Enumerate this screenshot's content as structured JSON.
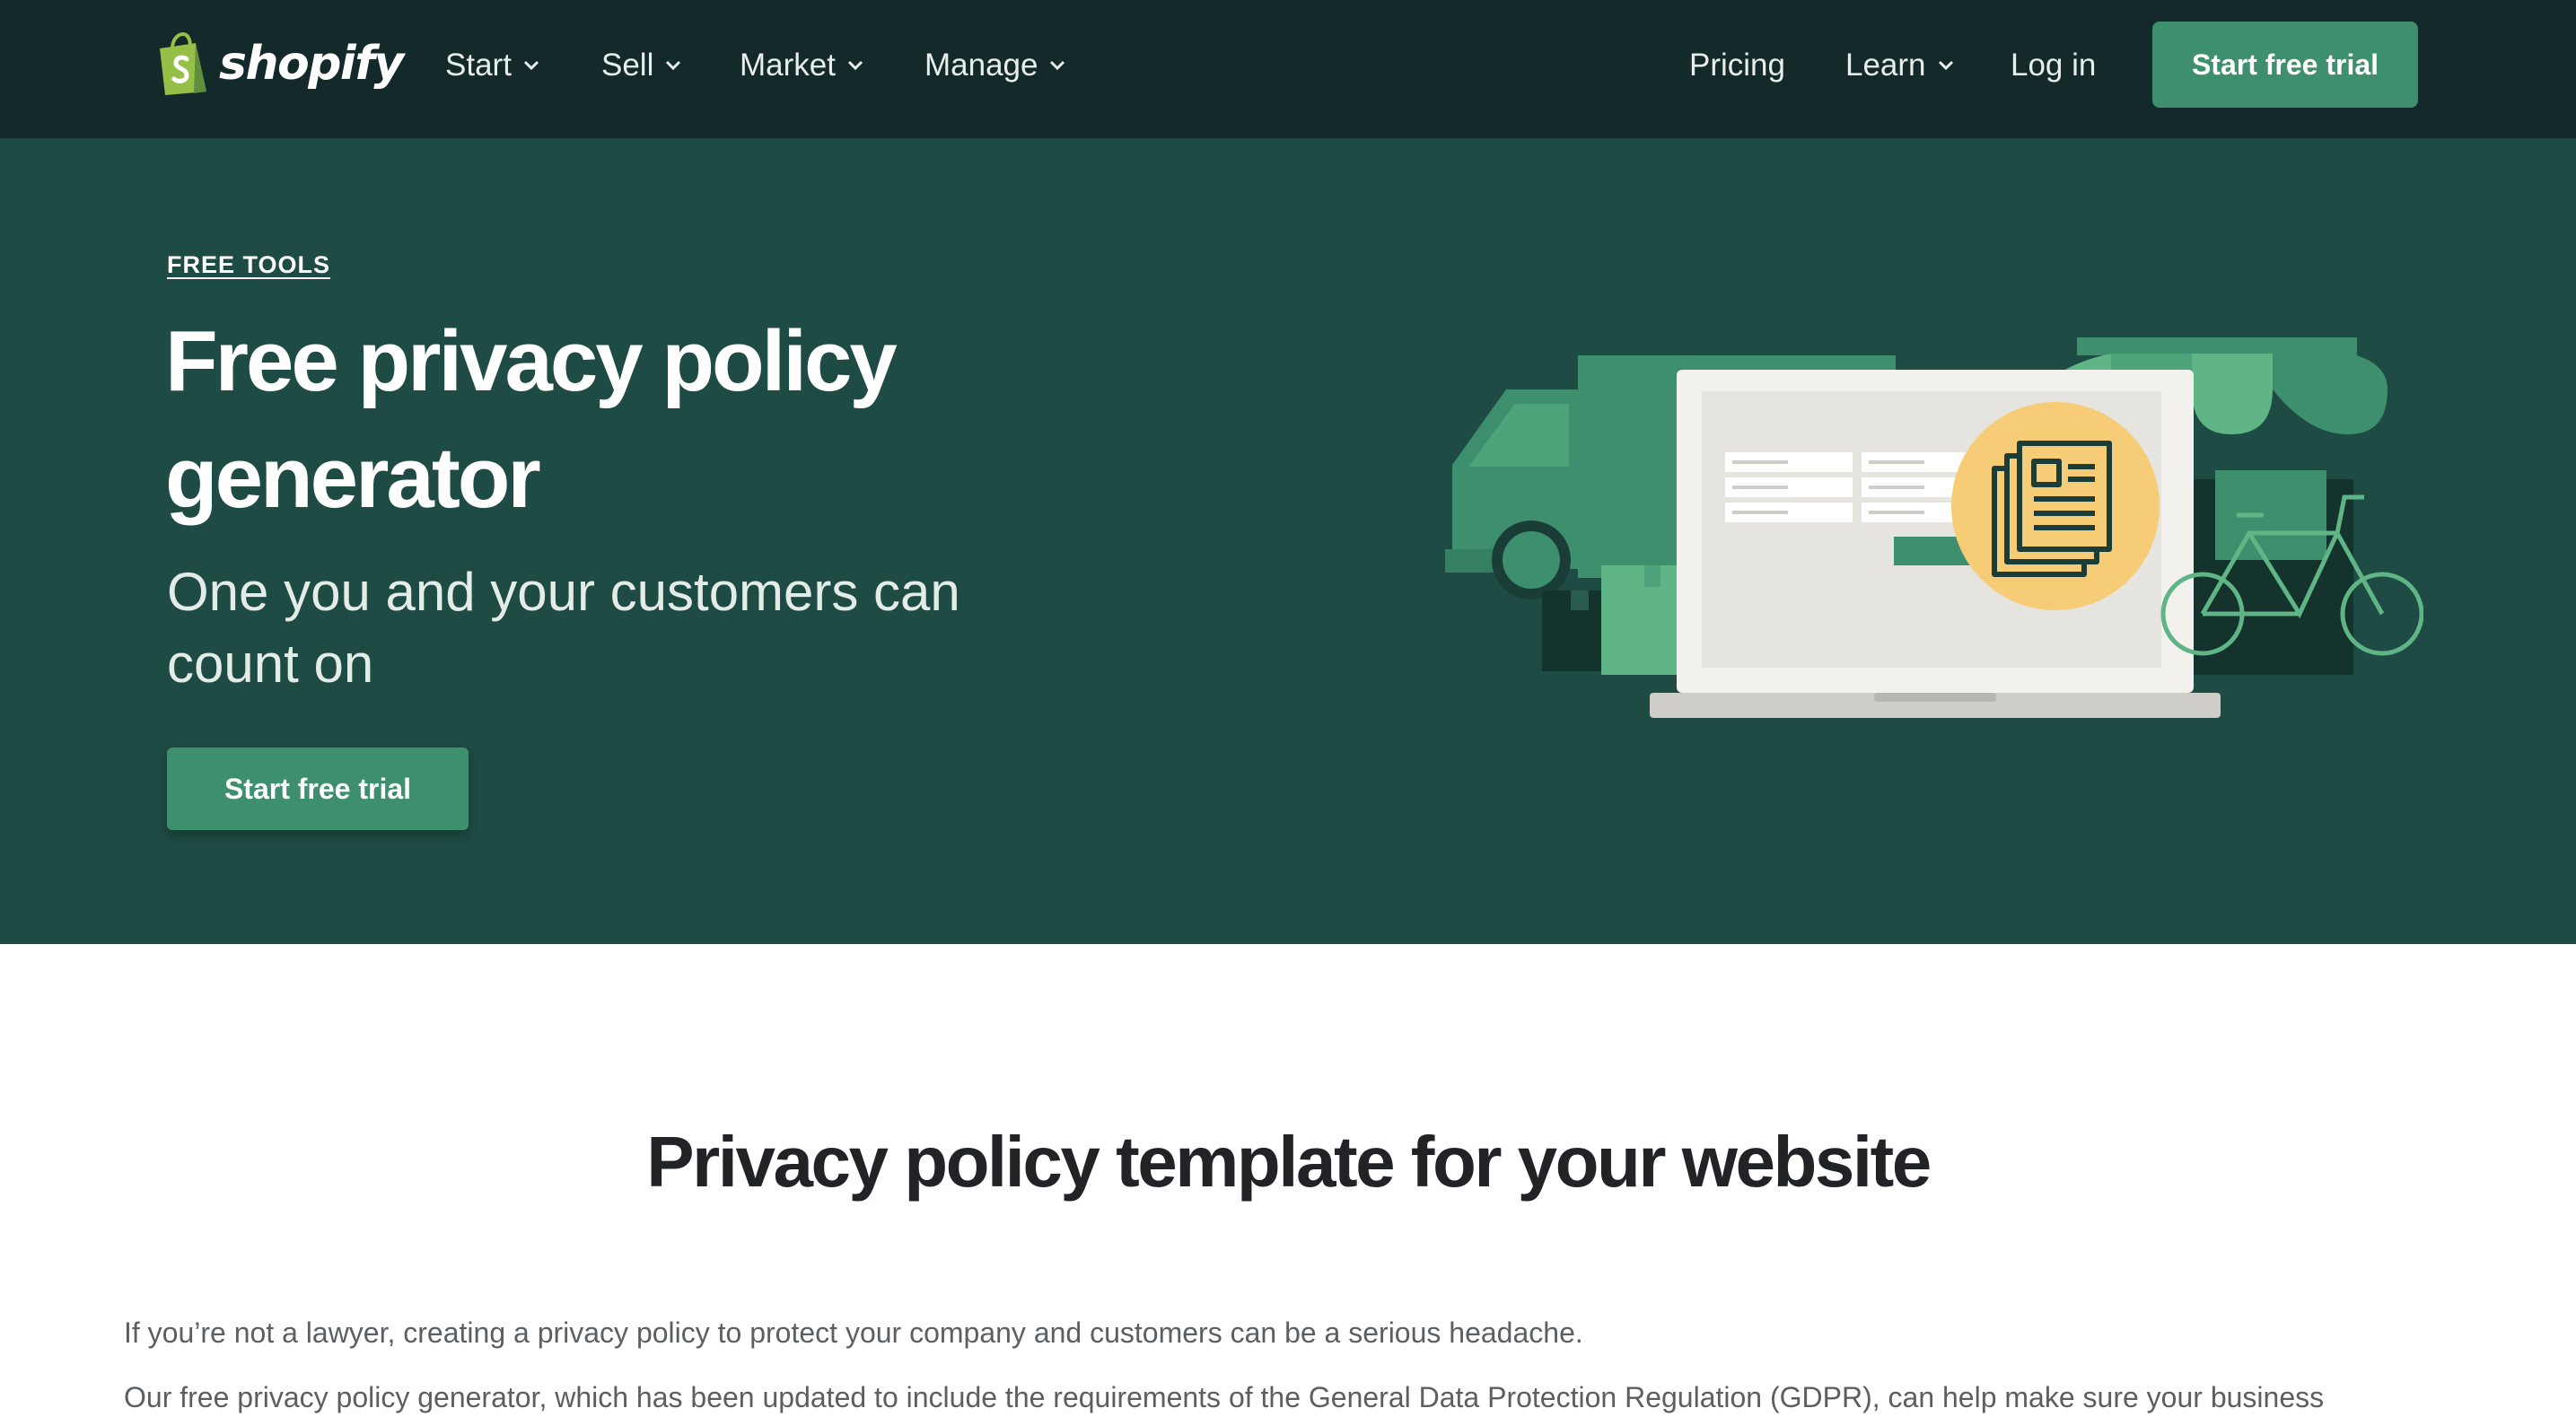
{
  "brand": {
    "name": "shopify",
    "colors": {
      "nav_bg": "#13292a",
      "hero_bg": "#1e4b43",
      "accent": "#3d8f6d",
      "logo_green": "#95bf47"
    }
  },
  "nav": {
    "items": [
      {
        "label": "Start",
        "dropdown": true
      },
      {
        "label": "Sell",
        "dropdown": true
      },
      {
        "label": "Market",
        "dropdown": true
      },
      {
        "label": "Manage",
        "dropdown": true
      }
    ],
    "right": {
      "pricing": "Pricing",
      "learn": "Learn",
      "login": "Log in",
      "cta": "Start free trial"
    }
  },
  "hero": {
    "eyebrow": "FREE TOOLS",
    "title_line1": "Free privacy policy",
    "title_line2": "generator",
    "subtitle": "One you and your customers can count on",
    "cta": "Start free trial",
    "illustration_icons": [
      "delivery-truck-icon",
      "laptop-icon",
      "document-icon",
      "storefront-icon",
      "bicycle-icon",
      "package-icon"
    ]
  },
  "content": {
    "title": "Privacy policy template for your website",
    "paragraph1": "If you’re not a lawyer, creating a privacy policy to protect your company and customers can be a serious headache.",
    "paragraph2": "Our free privacy policy generator, which has been updated to include the requirements of the General Data Protection Regulation (GDPR), can help make sure your business"
  }
}
